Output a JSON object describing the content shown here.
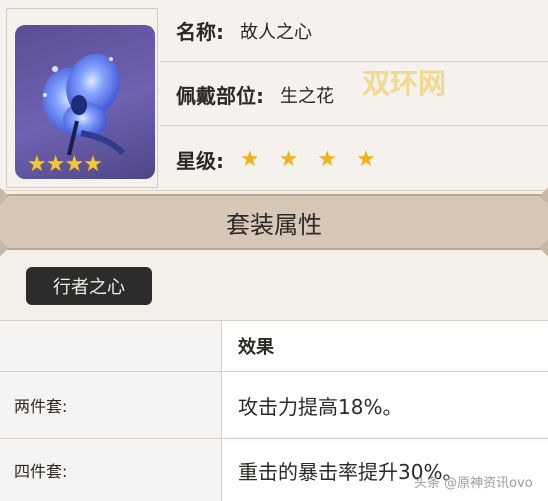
{
  "artifact": {
    "name_label": "名称:",
    "name_value": "故人之心",
    "slot_label": "佩戴部位:",
    "slot_value": "生之花",
    "rarity_label": "星级:",
    "rarity_stars": "★★★★",
    "rarity_stars_icon": "★ ★ ★ ★",
    "icon": "blue-flower-icon"
  },
  "watermarks": {
    "top": "双环网",
    "bottom": "头条 @原神资讯ovo"
  },
  "set": {
    "header": "套装属性",
    "name": "行者之心"
  },
  "table": {
    "effect_header": "效果",
    "rows": [
      {
        "label": "两件套:",
        "effect": "攻击力提高18%。"
      },
      {
        "label": "四件套:",
        "effect": "重击的暴击率提升30%。"
      }
    ]
  },
  "colors": {
    "star_gold": "#f0b21e",
    "header_bg": "#d6c7b6",
    "icon_bg": "#5f53a1"
  }
}
